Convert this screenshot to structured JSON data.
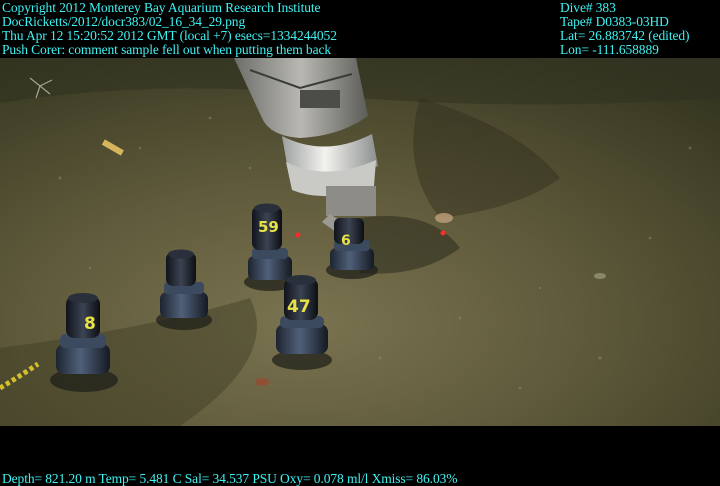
{
  "header_left": [
    "Copyright 2012 Monterey Bay Aquarium Research Institute",
    "DocRicketts/2012/docr383/02_16_34_29.png",
    "Thu Apr 12 15:20:52 2012 GMT (local +7)  esecs=1334244052",
    "Push Corer: comment sample fell out when putting them back"
  ],
  "header_right": [
    "Dive# 383",
    "Tape# D0383-03HD",
    "Lat= 26.883742 (edited)",
    "Lon= -111.658889"
  ],
  "footer": "Depth= 821.20 m  Temp= 5.481 C  Sal= 34.537 PSU  Oxy= 0.078 ml/l  Xmiss= 86.03%",
  "corer_labels": [
    "8",
    "",
    "59",
    "6",
    "47"
  ],
  "colors": {
    "overlay_text": "#3ff2f2",
    "seafloor": "#5e5a38",
    "letterbox": "#000000"
  }
}
